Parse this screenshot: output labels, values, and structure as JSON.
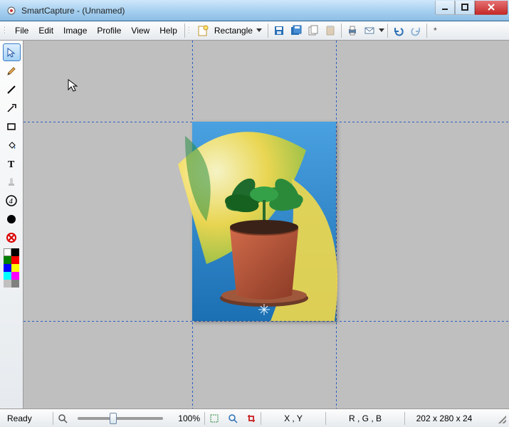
{
  "window": {
    "title": "SmartCapture - (Unnamed)"
  },
  "menu": {
    "file": "File",
    "edit": "Edit",
    "image": "Image",
    "profile": "Profile",
    "view": "View",
    "help": "Help"
  },
  "toolbar": {
    "capture_new_icon": "new-capture",
    "capture_type_label": "Rectangle",
    "buttons": {
      "save": "save",
      "saveall": "saveall",
      "copy": "copy",
      "paste": "paste",
      "print": "print",
      "mail": "mail",
      "undo": "undo",
      "redo": "redo"
    },
    "star": "*"
  },
  "tools": {
    "list": [
      {
        "name": "pointer",
        "selected": true
      },
      {
        "name": "pencil"
      },
      {
        "name": "line"
      },
      {
        "name": "arrow"
      },
      {
        "name": "rectangle"
      },
      {
        "name": "bucket"
      },
      {
        "name": "text"
      },
      {
        "name": "stamp"
      },
      {
        "name": "step-number"
      },
      {
        "name": "filled-circle"
      },
      {
        "name": "delete-circle"
      }
    ]
  },
  "palette_colors": [
    [
      "#ffffff",
      "#000000"
    ],
    [
      "#008000",
      "#ff0000"
    ],
    [
      "#0000ff",
      "#ffff00"
    ],
    [
      "#00ffff",
      "#ff00ff"
    ],
    [
      "#c0c0c0",
      "#808080"
    ]
  ],
  "status": {
    "ready": "Ready",
    "zoom": "100%",
    "xy": "X , Y",
    "rgb": "R , G , B",
    "dims": "202 x 280 x 24"
  },
  "slider": {
    "value_percent": 40
  },
  "image": {
    "description": "potted green plant on blue/yellow Windows-like backdrop"
  }
}
